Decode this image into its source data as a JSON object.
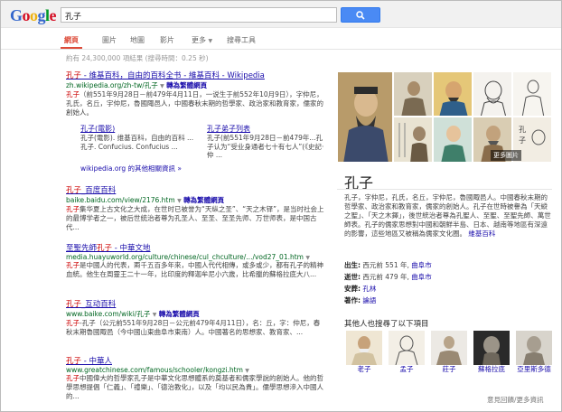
{
  "header": {
    "logo": "Google",
    "query": "孔子"
  },
  "tabs": [
    "網頁",
    "圖片",
    "地圖",
    "影片",
    "更多",
    "搜尋工具"
  ],
  "stats": "約有 24,300,000 項結果 (搜尋時間：0.25 秒)",
  "results": [
    {
      "title_hl": "孔子",
      "title_rest": " - 维基百科，自由的百科全书 - 維基百科 - Wikipedia",
      "url": "zh.wikipedia.org/zh-tw/孔子",
      "translate": "轉為繁體網頁",
      "snippet_hl": "孔子",
      "snippet": "（前551年9月28日－前479年4月11日，一说生于前552年10月9日），字仲尼，孔氏，名丘，宇仲尼，魯國陬邑人，中國春秋末期的哲學家、政治家和教育家，儒家的創始人。"
    },
    {
      "title_hl": "孔子",
      "title_rest": "_百度百科",
      "url": "baike.baidu.com/view/2176.htm",
      "translate": "轉為繁體網頁",
      "snippet_hl": "孔子",
      "snippet": "集华夏上古文化之大成，在世时已被誉为“天纵之圣”、“天之木铎”，是当时社会上的最博学者之一，被后世统治者尊为孔圣人、至圣、至圣先师、万世师表，是中国古代..."
    },
    {
      "title_hl": "孔子",
      "title_pre": "至聖先師",
      "title_rest": " - 中華文地",
      "url": "media.huayuworld.org/culture/chinese/cul_chculture/.../vod27_01.htm",
      "translate": "",
      "snippet_hl": "孔子",
      "snippet": "是中國人的代表，兩千五百多年來，中國人代代相傳，或多或少，都有孔子的精神血統。他生在周靈王二十一年，比印度的釋迦牟尼小六歲，比希臘的蘇格拉底大八..."
    },
    {
      "title_hl": "孔子",
      "title_rest": "_互动百科",
      "url": "www.baike.com/wiki/孔子",
      "translate": "轉為繁體網頁",
      "snippet_hl": "孔子",
      "snippet": "-孔子（公元前551年9月28日－公元前479年4月11日），名：丘，字：仲尼，春秋末期魯國陬邑（今中國山東曲阜市東南）人。中國著名的思想家、教育家、..."
    },
    {
      "title_hl": "孔子",
      "title_rest": " - 中華人",
      "url": "www.greatchinese.com/famous/schooler/kongzi.htm",
      "translate": "",
      "snippet_hl": "孔子",
      "snippet": "中國偉大的哲學家孔子是中華文化思想體系的奠基者和儒家學說的創始人。他的哲學思想提倡「仁義」、「禮樂」、「德治教化」，以及「均以民為貴」。儒學思想滲入中國人的..."
    }
  ],
  "sublinks": [
    {
      "title": "孔子(電影)",
      "snippet": "孔子(電影). 维基百科，自由的百科 ... 孔子. Confucius. Confucius ..."
    },
    {
      "title": "孔子弟子列表",
      "snippet": "孔子(前551年9月28日－前479年...孔子认为“受业身通者七十有七人”(《史記·仲 ..."
    }
  ],
  "more_link": "wikipedia.org 的其他相關資訊 »",
  "knowledge_panel": {
    "more_images": "更多圖片",
    "title": "孔子",
    "description": "孔子，字仲尼，孔氏，名丘，宇仲尼，魯國陬邑人。中國春秋末期的哲學家、政治家和教育家，儒家的創始人。孔子在世時被譽為「天縱之聖」、「天之木鐸」，後世統治者尊為孔聖人、至聖、至聖先師、萬世師表。孔子的儒家思想對中國和朝鮮半島、日本、越南等地區有深遠的影響，這些地區又被稱為儒家文化圈。",
    "source": "維基百科",
    "facts": [
      {
        "label": "出生:",
        "value": "西元前 551 年,",
        "link": "曲阜市"
      },
      {
        "label": "逝世:",
        "value": "西元前 479 年,",
        "link": "曲阜市"
      },
      {
        "label": "安葬:",
        "value": "",
        "link": "孔林"
      },
      {
        "label": "著作:",
        "value": "",
        "link": "論語"
      }
    ],
    "also_search_title": "其他人也搜尋了以下項目",
    "also_search": [
      "老子",
      "孟子",
      "莊子",
      "蘇格拉底",
      "亞里斯多德"
    ],
    "feedback": "意見回饋/更多資訊"
  }
}
